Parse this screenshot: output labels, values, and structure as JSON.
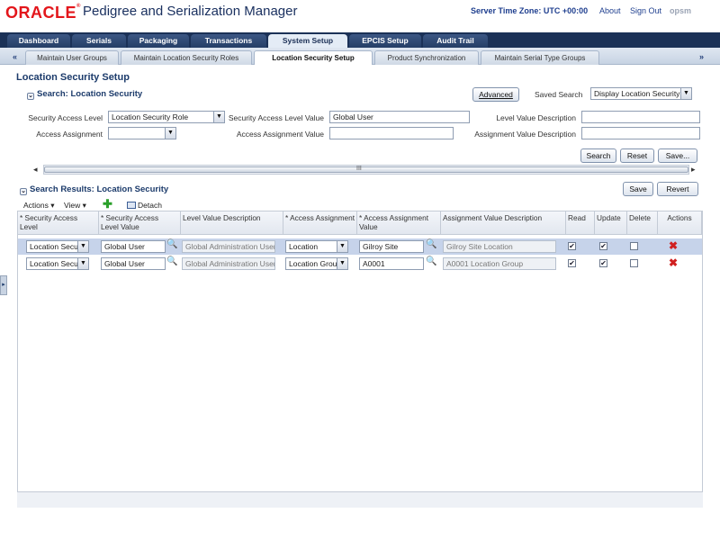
{
  "header": {
    "brand": "ORACLE",
    "app_title": "Pedigree and Serialization Manager",
    "server_time": "Server Time Zone: UTC +00:00",
    "about": "About",
    "sign_out": "Sign Out",
    "user": "opsm"
  },
  "main_tabs": [
    {
      "label": "Dashboard"
    },
    {
      "label": "Serials"
    },
    {
      "label": "Packaging"
    },
    {
      "label": "Transactions"
    },
    {
      "label": "System Setup"
    },
    {
      "label": "EPCIS Setup"
    },
    {
      "label": "Audit Trail"
    }
  ],
  "sub_tabs": [
    {
      "label": "Maintain User Groups"
    },
    {
      "label": "Maintain Location Security Roles"
    },
    {
      "label": "Location Security Setup"
    },
    {
      "label": "Product Synchronization"
    },
    {
      "label": "Maintain Serial Type Groups"
    }
  ],
  "page": {
    "title": "Location Security Setup"
  },
  "search": {
    "title": "Search: Location Security",
    "advanced": "Advanced",
    "saved_search_label": "Saved Search",
    "saved_search_value": "Display Location Security",
    "fields": {
      "security_access_level_label": "Security Access Level",
      "security_access_level_value": "Location Security Role",
      "security_access_level_value_label": "Security Access Level Value",
      "security_access_level_value_value": "Global User",
      "level_value_description_label": "Level Value Description",
      "level_value_description_value": "",
      "access_assignment_label": "Access Assignment",
      "access_assignment_value": "",
      "access_assignment_value_label": "Access Assignment Value",
      "access_assignment_value_value": "",
      "assignment_value_description_label": "Assignment Value Description",
      "assignment_value_description_value": ""
    },
    "buttons": {
      "search": "Search",
      "reset": "Reset",
      "save": "Save..."
    }
  },
  "results": {
    "title": "Search Results: Location Security",
    "save": "Save",
    "revert": "Revert",
    "toolbar": {
      "actions": "Actions",
      "view": "View",
      "detach": "Detach"
    },
    "columns": [
      "* Security Access Level",
      "* Security Access Level Value",
      "Level Value Description",
      "* Access Assignment",
      "* Access Assignment Value",
      "Assignment Value Description",
      "Read",
      "Update",
      "Delete",
      "Actions"
    ],
    "rows": [
      {
        "level": "Location Secu",
        "level_value": "Global User",
        "level_desc": "Global Administration User",
        "assignment": "Location",
        "assignment_value": "Gilroy Site",
        "assignment_desc": "Gilroy Site Location",
        "read": true,
        "update": true,
        "delete": false
      },
      {
        "level": "Location Secu",
        "level_value": "Global User",
        "level_desc": "Global Administration User",
        "assignment": "Location Grou",
        "assignment_value": "A0001",
        "assignment_desc": "A0001 Location Group",
        "read": true,
        "update": true,
        "delete": false
      }
    ]
  },
  "icons": {
    "prev_tabs": "«",
    "next_tabs": "»",
    "dropdown": "▼",
    "disclose": "⌄",
    "search_glass": "🔍",
    "add": "✚",
    "delete": "✖",
    "check": "✔",
    "scroll_left": "◂",
    "scroll_right": "▸",
    "grip": "III",
    "expand_panel": "▸"
  }
}
